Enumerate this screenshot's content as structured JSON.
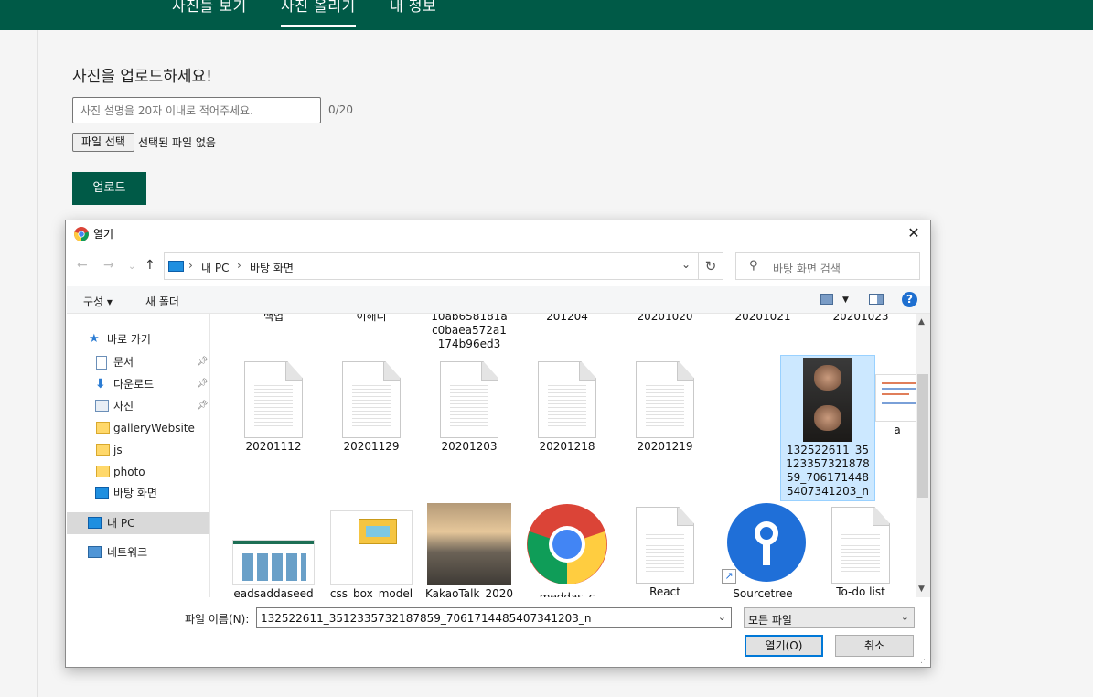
{
  "nav": {
    "tabs": [
      {
        "label": "사진들 보기",
        "active": false
      },
      {
        "label": "사진 올리기",
        "active": true
      },
      {
        "label": "내 정보",
        "active": false
      }
    ]
  },
  "form": {
    "title": "사진을 업로드하세요!",
    "description_placeholder": "사진 설명을 20자 이내로 적어주세요.",
    "counter": "0/20",
    "file_button": "파일 선택",
    "file_status": "선택된 파일 없음",
    "upload_button": "업로드"
  },
  "dialog": {
    "title": "열기",
    "close": "✕",
    "breadcrumb": [
      "내 PC",
      "바탕 화면"
    ],
    "search_placeholder": "바탕 화면 검색",
    "commands": {
      "organize": "구성 ▾",
      "new_folder": "새 폴더"
    },
    "sidebar": [
      {
        "label": "바로 가기",
        "icon": "star-icon",
        "pinned": false
      },
      {
        "label": "문서",
        "icon": "document-icon",
        "pinned": true
      },
      {
        "label": "다운로드",
        "icon": "download-icon",
        "pinned": true
      },
      {
        "label": "사진",
        "icon": "pictures-icon",
        "pinned": true
      },
      {
        "label": "galleryWebsite",
        "icon": "folder-icon",
        "pinned": false
      },
      {
        "label": "js",
        "icon": "folder-icon",
        "pinned": false
      },
      {
        "label": "photo",
        "icon": "folder-icon",
        "pinned": false
      },
      {
        "label": "바탕 화면",
        "icon": "desktop-icon",
        "pinned": false
      },
      {
        "label": "내 PC",
        "icon": "pc-icon",
        "pinned": false,
        "selected": true
      },
      {
        "label": "네트워크",
        "icon": "network-icon",
        "pinned": false
      }
    ],
    "files_row0": [
      "백업",
      "이해니",
      "10ab658181ac0baea572a1174b96ed3",
      "201204",
      "20201020",
      "20201021",
      "20201023"
    ],
    "files_row1": [
      {
        "name": "20201112",
        "kind": "doc"
      },
      {
        "name": "20201129",
        "kind": "doc"
      },
      {
        "name": "20201203",
        "kind": "doc"
      },
      {
        "name": "20201218",
        "kind": "doc"
      },
      {
        "name": "20201219",
        "kind": "doc"
      },
      {
        "name": "132522611_3512335732187859_7061714485407341203_n",
        "kind": "photo",
        "selected": true
      },
      {
        "name": "a",
        "kind": "code"
      }
    ],
    "files_row2": [
      "eadsaddaseed",
      "css_box_model",
      "KakaoTalk_2020",
      "meddas_c",
      "React",
      "Sourcetree",
      "To-do list"
    ],
    "filename_label": "파일 이름(N):",
    "filename_value": "132522611_3512335732187859_7061714485407341203_n",
    "filetype_value": "모든 파일",
    "open_button": "열기(O)",
    "cancel_button": "취소",
    "colors": {
      "accent": "#005a47",
      "selection": "#cce8ff",
      "button_focus": "#0078d7"
    }
  }
}
